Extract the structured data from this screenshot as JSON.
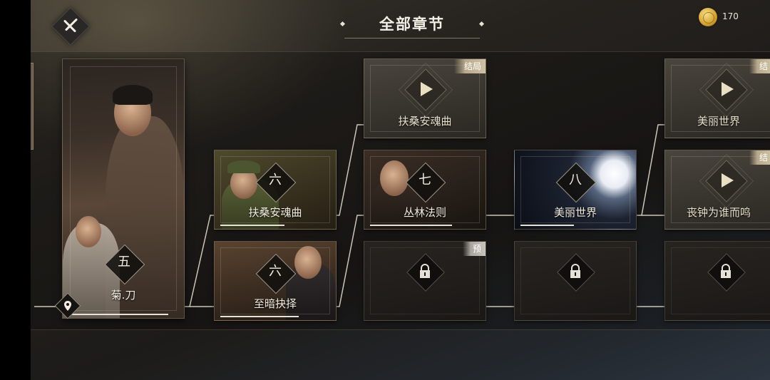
{
  "header": {
    "title": "全部章节",
    "coin_count": "170"
  },
  "icons": {
    "back": "close-sword-icon",
    "coin": "gold-coin-icon",
    "play": "play-icon",
    "lock": "lock-icon",
    "location": "location-pin-icon"
  },
  "chapters": {
    "ch5": {
      "number": "五",
      "title": "菊.刀"
    },
    "ch6a": {
      "number": "六",
      "title": "扶桑安魂曲"
    },
    "ch6b": {
      "number": "六",
      "title": "至暗抉择"
    },
    "ch7": {
      "number": "七",
      "title": "丛林法则"
    },
    "ch8": {
      "number": "八",
      "title": "美丽世界"
    }
  },
  "endings": {
    "e1": {
      "title": "扶桑安魂曲",
      "tag": "结局"
    },
    "e2": {
      "title": "美丽世界",
      "tag": "结"
    },
    "e3": {
      "title": "丧钟为谁而鸣",
      "tag": "结"
    }
  },
  "locked": {
    "tag_preview": "预"
  },
  "colors": {
    "accent_gold": "#cfc1a4",
    "text_light": "#f1ece0",
    "panel_dark": "#1a1816"
  }
}
